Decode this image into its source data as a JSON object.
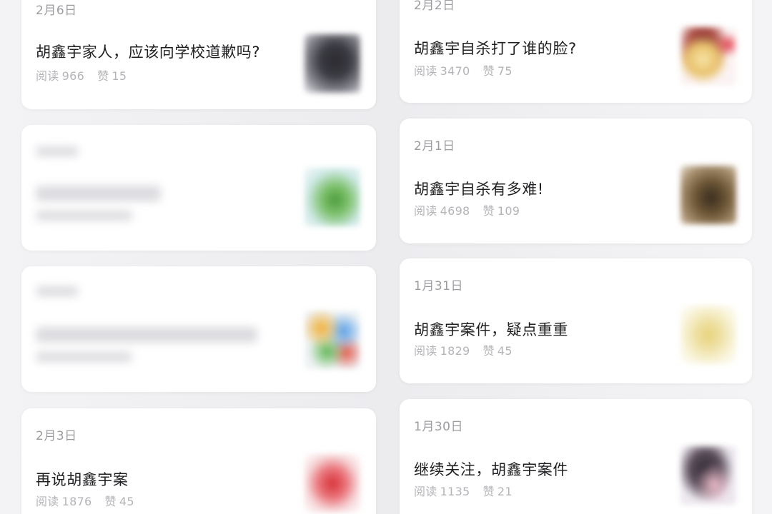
{
  "left_column": [
    {
      "date": "2月6日",
      "title": "胡鑫宇家人，应该向学校道歉吗?",
      "reads_label": "阅读",
      "reads": "966",
      "likes_label": "赞",
      "likes": "15",
      "thumbnail_icon": "dark-photo-thumbnail"
    },
    {
      "blurred": true,
      "thumbnail_icon": "green-photo-thumbnail"
    },
    {
      "blurred": true,
      "thumbnail_icon": "colorful-photo-thumbnail"
    },
    {
      "date": "2月3日",
      "title": "再说胡鑫宇案",
      "reads_label": "阅读",
      "reads": "1876",
      "likes_label": "赞",
      "likes": "45",
      "thumbnail_icon": "red-photo-thumbnail"
    }
  ],
  "right_column": [
    {
      "date": "2月2日",
      "title": "胡鑫宇自杀打了谁的脸?",
      "reads_label": "阅读",
      "reads": "3470",
      "likes_label": "赞",
      "likes": "75",
      "thumbnail_icon": "cartoon-girl-thumbnail"
    },
    {
      "date": "2月1日",
      "title": "胡鑫宇自杀有多难!",
      "reads_label": "阅读",
      "reads": "4698",
      "likes_label": "赞",
      "likes": "109",
      "thumbnail_icon": "brown-photo-thumbnail"
    },
    {
      "date": "1月31日",
      "title": "胡鑫宇案件，疑点重重",
      "reads_label": "阅读",
      "reads": "1829",
      "likes_label": "赞",
      "likes": "45",
      "thumbnail_icon": "yellow-photo-thumbnail"
    },
    {
      "date": "1月30日",
      "title": "继续关注，胡鑫宇案件",
      "reads_label": "阅读",
      "reads": "1135",
      "likes_label": "赞",
      "likes": "21",
      "thumbnail_icon": "person-photo-thumbnail"
    }
  ]
}
